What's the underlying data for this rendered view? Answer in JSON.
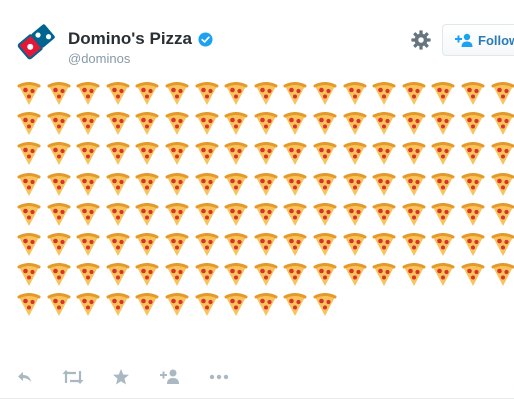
{
  "tweet": {
    "author_name": "Domino's Pizza",
    "author_handle": "@dominos",
    "verified": true,
    "follow_label": "Follow",
    "emoji": "pizza",
    "emoji_count": 130,
    "emoji_per_row": 17
  },
  "colors": {
    "name": "#292f33",
    "handle": "#8899a6",
    "accent": "#1da1f2",
    "logo_blue": "#006491",
    "logo_red": "#e31837",
    "action_icons": "#aab8c2"
  },
  "icons": {
    "settings": "gear-icon",
    "follow": "add-person-icon",
    "actions": [
      "reply-icon",
      "retweet-icon",
      "favorite-icon",
      "follow-user-icon",
      "more-icon"
    ]
  }
}
